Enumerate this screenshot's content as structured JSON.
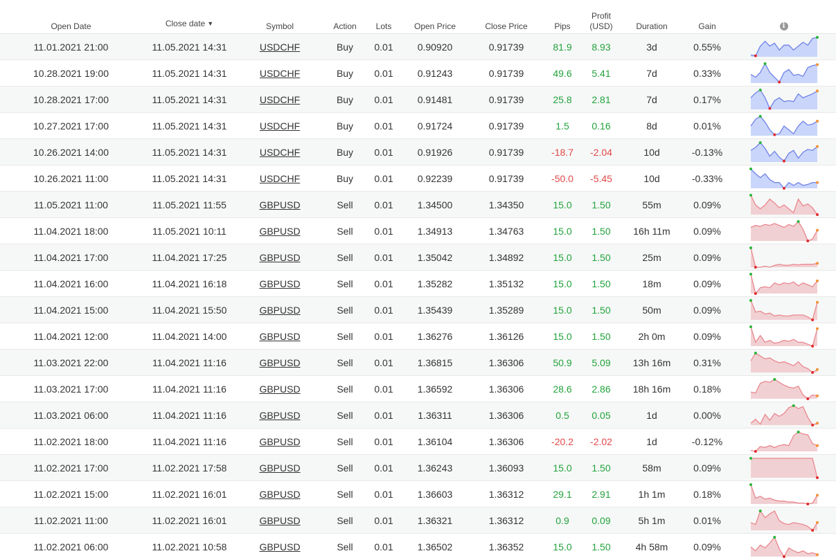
{
  "headers": {
    "open_date": "Open Date",
    "close_date": "Close date",
    "close_sort_arrow": "▼",
    "symbol": "Symbol",
    "action": "Action",
    "lots": "Lots",
    "open_price": "Open Price",
    "close_price": "Close Price",
    "pips": "Pips",
    "profit_line1": "Profit",
    "profit_line2": "(USD)",
    "duration": "Duration",
    "gain": "Gain",
    "info": "i"
  },
  "colors": {
    "positive": "#22a23b",
    "negative": "#e24848",
    "buy_fill": "#c9d5fb",
    "buy_line": "#6f82e6",
    "sell_fill": "#f1d0d3",
    "sell_line": "#e9878e",
    "marker_high": "#2bb53a",
    "marker_low": "#e02d2d",
    "marker_last": "#f2923a"
  },
  "rows": [
    {
      "open": "11.01.2021 21:00",
      "close": "11.05.2021 14:31",
      "symbol": "USDCHF",
      "action": "Buy",
      "lots": "0.01",
      "open_price": "0.90920",
      "close_price": "0.91739",
      "pips": "81.9",
      "profit": "8.93",
      "duration": "3d",
      "gain": "0.55%",
      "sign": "pos",
      "spark": [
        0.1,
        0.05,
        0.55,
        0.8,
        0.55,
        0.7,
        0.35,
        0.6,
        0.6,
        0.35,
        0.55,
        0.75,
        0.6,
        0.95,
        1.0
      ]
    },
    {
      "open": "10.28.2021 19:00",
      "close": "11.05.2021 14:31",
      "symbol": "USDCHF",
      "action": "Buy",
      "lots": "0.01",
      "open_price": "0.91243",
      "close_price": "0.91739",
      "pips": "49.6",
      "profit": "5.41",
      "duration": "7d",
      "gain": "0.33%",
      "sign": "pos",
      "spark": [
        0.45,
        0.3,
        0.55,
        1.0,
        0.55,
        0.3,
        0.05,
        0.55,
        0.7,
        0.4,
        0.45,
        0.35,
        0.8,
        0.9,
        0.95
      ]
    },
    {
      "open": "10.28.2021 17:00",
      "close": "11.05.2021 14:31",
      "symbol": "USDCHF",
      "action": "Buy",
      "lots": "0.01",
      "open_price": "0.91481",
      "close_price": "0.91739",
      "pips": "25.8",
      "profit": "2.81",
      "duration": "7d",
      "gain": "0.17%",
      "sign": "pos",
      "spark": [
        0.6,
        0.85,
        1.0,
        0.6,
        0.05,
        0.45,
        0.6,
        0.4,
        0.45,
        0.4,
        0.8,
        0.6,
        0.7,
        0.8,
        0.95
      ]
    },
    {
      "open": "10.27.2021 17:00",
      "close": "11.05.2021 14:31",
      "symbol": "USDCHF",
      "action": "Buy",
      "lots": "0.01",
      "open_price": "0.91724",
      "close_price": "0.91739",
      "pips": "1.5",
      "profit": "0.16",
      "duration": "8d",
      "gain": "0.01%",
      "sign": "pos",
      "spark": [
        0.5,
        0.85,
        1.0,
        0.7,
        0.3,
        0.05,
        0.1,
        0.5,
        0.3,
        0.1,
        0.5,
        0.75,
        0.55,
        0.6,
        0.75
      ]
    },
    {
      "open": "10.26.2021 14:00",
      "close": "11.05.2021 14:31",
      "symbol": "USDCHF",
      "action": "Buy",
      "lots": "0.01",
      "open_price": "0.91926",
      "close_price": "0.91739",
      "pips": "-18.7",
      "profit": "-2.04",
      "duration": "10d",
      "gain": "-0.13%",
      "sign": "neg",
      "spark": [
        0.6,
        0.75,
        1.0,
        0.7,
        0.3,
        0.55,
        0.25,
        0.05,
        0.45,
        0.6,
        0.2,
        0.5,
        0.65,
        0.6,
        0.8
      ]
    },
    {
      "open": "10.26.2021 11:00",
      "close": "11.05.2021 14:31",
      "symbol": "USDCHF",
      "action": "Buy",
      "lots": "0.01",
      "open_price": "0.92239",
      "close_price": "0.91739",
      "pips": "-50.0",
      "profit": "-5.45",
      "duration": "10d",
      "gain": "-0.33%",
      "sign": "neg",
      "spark": [
        1.0,
        0.75,
        0.55,
        0.75,
        0.45,
        0.3,
        0.3,
        0.0,
        0.3,
        0.15,
        0.3,
        0.15,
        0.2,
        0.3,
        0.3
      ]
    },
    {
      "open": "11.05.2021 11:00",
      "close": "11.05.2021 11:55",
      "symbol": "GBPUSD",
      "action": "Sell",
      "lots": "0.01",
      "open_price": "1.34500",
      "close_price": "1.34350",
      "pips": "15.0",
      "profit": "1.50",
      "duration": "55m",
      "gain": "0.09%",
      "sign": "pos",
      "spark": [
        1.0,
        0.5,
        0.3,
        0.5,
        0.8,
        0.6,
        0.35,
        0.5,
        0.3,
        0.1,
        0.8,
        0.45,
        0.55,
        0.35,
        0.0
      ]
    },
    {
      "open": "11.04.2021 18:00",
      "close": "11.05.2021 10:11",
      "symbol": "GBPUSD",
      "action": "Sell",
      "lots": "0.01",
      "open_price": "1.34913",
      "close_price": "1.34763",
      "pips": "15.0",
      "profit": "1.50",
      "duration": "16h 11m",
      "gain": "0.09%",
      "sign": "pos",
      "spark": [
        0.7,
        0.8,
        0.75,
        0.85,
        0.8,
        0.9,
        0.8,
        0.7,
        0.85,
        0.75,
        1.0,
        0.6,
        0.0,
        0.1,
        0.55
      ]
    },
    {
      "open": "11.04.2021 17:00",
      "close": "11.04.2021 17:25",
      "symbol": "GBPUSD",
      "action": "Sell",
      "lots": "0.01",
      "open_price": "1.35042",
      "close_price": "1.34892",
      "pips": "15.0",
      "profit": "1.50",
      "duration": "25m",
      "gain": "0.09%",
      "sign": "pos",
      "spark": [
        1.0,
        0.0,
        0.0,
        0.05,
        0.0,
        0.1,
        0.15,
        0.1,
        0.1,
        0.15,
        0.12,
        0.15,
        0.15,
        0.15,
        0.2
      ]
    },
    {
      "open": "11.04.2021 16:00",
      "close": "11.04.2021 16:18",
      "symbol": "GBPUSD",
      "action": "Sell",
      "lots": "0.01",
      "open_price": "1.35282",
      "close_price": "1.35132",
      "pips": "15.0",
      "profit": "1.50",
      "duration": "18m",
      "gain": "0.09%",
      "sign": "pos",
      "spark": [
        1.0,
        0.0,
        0.3,
        0.35,
        0.3,
        0.55,
        0.45,
        0.55,
        0.5,
        0.6,
        0.4,
        0.55,
        0.45,
        0.35,
        0.65
      ]
    },
    {
      "open": "11.04.2021 15:00",
      "close": "11.04.2021 15:50",
      "symbol": "GBPUSD",
      "action": "Sell",
      "lots": "0.01",
      "open_price": "1.35439",
      "close_price": "1.35289",
      "pips": "15.0",
      "profit": "1.50",
      "duration": "50m",
      "gain": "0.09%",
      "sign": "pos",
      "spark": [
        1.0,
        0.4,
        0.45,
        0.3,
        0.35,
        0.2,
        0.25,
        0.2,
        0.2,
        0.25,
        0.25,
        0.25,
        0.15,
        0.0,
        0.9
      ]
    },
    {
      "open": "11.04.2021 12:00",
      "close": "11.04.2021 14:00",
      "symbol": "GBPUSD",
      "action": "Sell",
      "lots": "0.01",
      "open_price": "1.36276",
      "close_price": "1.36126",
      "pips": "15.0",
      "profit": "1.50",
      "duration": "2h 0m",
      "gain": "0.09%",
      "sign": "pos",
      "spark": [
        1.0,
        0.2,
        0.55,
        0.2,
        0.3,
        0.15,
        0.2,
        0.3,
        0.25,
        0.35,
        0.2,
        0.2,
        0.1,
        0.0,
        0.9
      ]
    },
    {
      "open": "11.03.2021 22:00",
      "close": "11.04.2021 11:16",
      "symbol": "GBPUSD",
      "action": "Sell",
      "lots": "0.01",
      "open_price": "1.36815",
      "close_price": "1.36306",
      "pips": "50.9",
      "profit": "5.09",
      "duration": "13h 16m",
      "gain": "0.31%",
      "sign": "pos",
      "spark": [
        0.6,
        1.0,
        0.85,
        0.7,
        0.75,
        0.6,
        0.5,
        0.55,
        0.45,
        0.35,
        0.55,
        0.3,
        0.2,
        0.0,
        0.15
      ]
    },
    {
      "open": "11.03.2021 17:00",
      "close": "11.04.2021 11:16",
      "symbol": "GBPUSD",
      "action": "Sell",
      "lots": "0.01",
      "open_price": "1.36592",
      "close_price": "1.36306",
      "pips": "28.6",
      "profit": "2.86",
      "duration": "18h 16m",
      "gain": "0.18%",
      "sign": "pos",
      "spark": [
        0.35,
        0.3,
        0.8,
        0.9,
        0.85,
        1.0,
        0.85,
        0.7,
        0.6,
        0.55,
        0.65,
        0.2,
        0.0,
        0.2,
        0.15
      ]
    },
    {
      "open": "11.03.2021 06:00",
      "close": "11.04.2021 11:16",
      "symbol": "GBPUSD",
      "action": "Sell",
      "lots": "0.01",
      "open_price": "1.36311",
      "close_price": "1.36306",
      "pips": "0.5",
      "profit": "0.05",
      "duration": "1d",
      "gain": "0.00%",
      "sign": "pos",
      "spark": [
        0.1,
        0.3,
        0.05,
        0.55,
        0.25,
        0.6,
        0.45,
        0.6,
        0.9,
        1.0,
        0.85,
        0.95,
        0.4,
        0.0,
        0.1
      ]
    },
    {
      "open": "11.02.2021 18:00",
      "close": "11.04.2021 11:16",
      "symbol": "GBPUSD",
      "action": "Sell",
      "lots": "0.01",
      "open_price": "1.36104",
      "close_price": "1.36306",
      "pips": "-20.2",
      "profit": "-2.02",
      "duration": "1d",
      "gain": "-0.12%",
      "sign": "neg",
      "spark": [
        0.05,
        0.0,
        0.25,
        0.2,
        0.3,
        0.2,
        0.3,
        0.35,
        0.3,
        0.8,
        1.0,
        0.9,
        0.85,
        0.4,
        0.3
      ]
    },
    {
      "open": "11.02.2021 17:00",
      "close": "11.02.2021 17:58",
      "symbol": "GBPUSD",
      "action": "Sell",
      "lots": "0.01",
      "open_price": "1.36243",
      "close_price": "1.36093",
      "pips": "15.0",
      "profit": "1.50",
      "duration": "58m",
      "gain": "0.09%",
      "sign": "pos",
      "spark": [
        1.0,
        1.0,
        1.0,
        1.0,
        1.0,
        1.0,
        1.0,
        1.0,
        1.0,
        1.0,
        1.0,
        1.0,
        1.0,
        1.0,
        0.0
      ]
    },
    {
      "open": "11.02.2021 15:00",
      "close": "11.02.2021 16:01",
      "symbol": "GBPUSD",
      "action": "Sell",
      "lots": "0.01",
      "open_price": "1.36603",
      "close_price": "1.36312",
      "pips": "29.1",
      "profit": "2.91",
      "duration": "1h 1m",
      "gain": "0.18%",
      "sign": "pos",
      "spark": [
        1.0,
        0.3,
        0.4,
        0.25,
        0.3,
        0.2,
        0.15,
        0.15,
        0.1,
        0.1,
        0.05,
        0.05,
        0.0,
        0.05,
        0.45
      ]
    },
    {
      "open": "11.02.2021 11:00",
      "close": "11.02.2021 16:01",
      "symbol": "GBPUSD",
      "action": "Sell",
      "lots": "0.01",
      "open_price": "1.36321",
      "close_price": "1.36312",
      "pips": "0.9",
      "profit": "0.09",
      "duration": "5h 1m",
      "gain": "0.01%",
      "sign": "pos",
      "spark": [
        0.4,
        0.3,
        1.0,
        0.65,
        0.85,
        1.0,
        0.5,
        0.35,
        0.3,
        0.4,
        0.35,
        0.3,
        0.2,
        0.0,
        0.4
      ]
    },
    {
      "open": "11.02.2021 06:00",
      "close": "11.02.2021 10:58",
      "symbol": "GBPUSD",
      "action": "Sell",
      "lots": "0.01",
      "open_price": "1.36502",
      "close_price": "1.36352",
      "pips": "15.0",
      "profit": "1.50",
      "duration": "4h 58m",
      "gain": "0.09%",
      "sign": "pos",
      "spark": [
        0.5,
        0.3,
        0.6,
        0.45,
        0.7,
        1.0,
        0.4,
        0.0,
        0.45,
        0.3,
        0.2,
        0.3,
        0.15,
        0.2,
        0.1
      ]
    }
  ]
}
